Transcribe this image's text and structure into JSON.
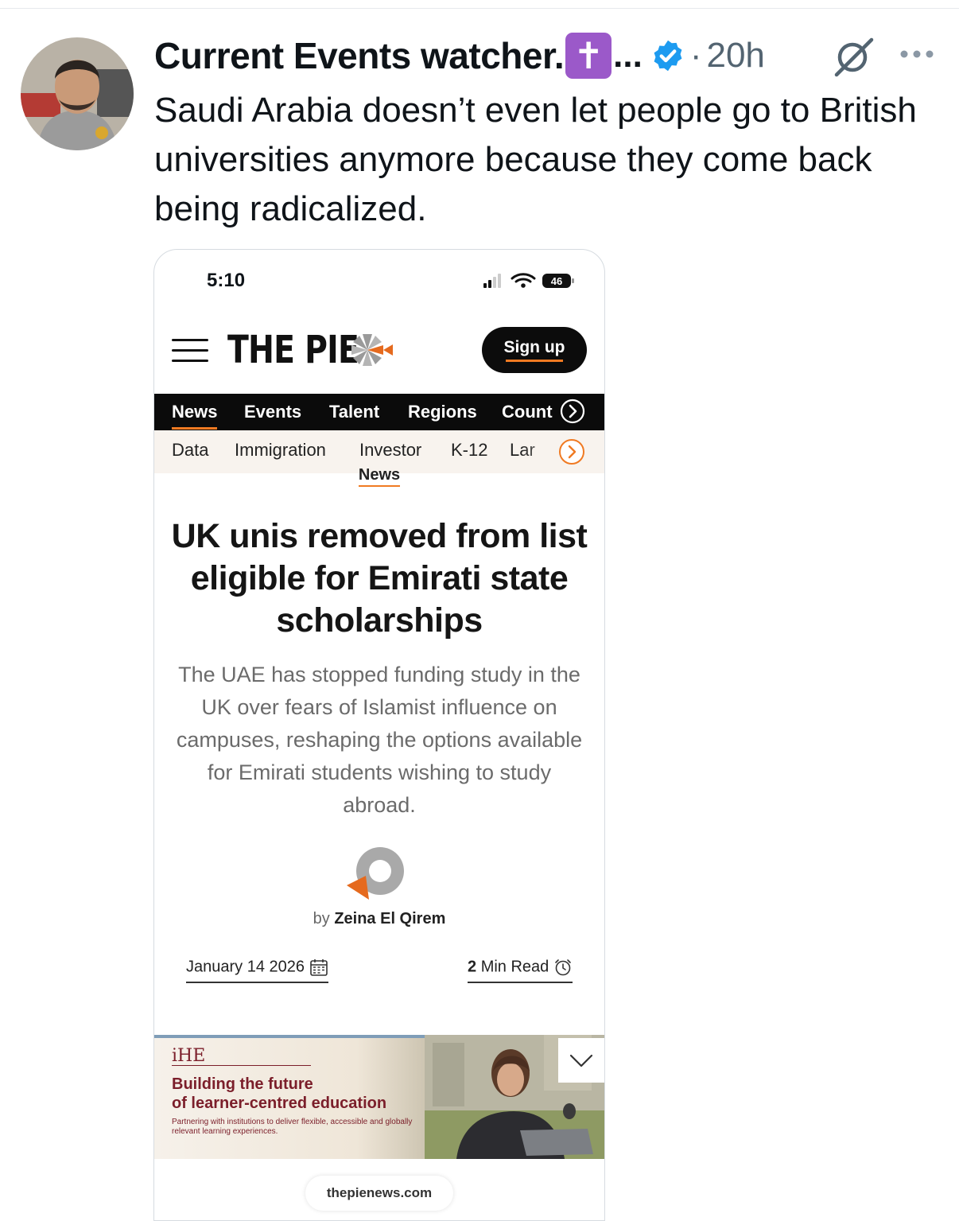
{
  "tweet": {
    "author_name": "Current Events watcher.",
    "author_emoji": "✝",
    "truncation": "...",
    "separator": "·",
    "time": "20h",
    "text": "Saudi Arabia doesn’t even let people go to British universities anymore because they come back being radicalized."
  },
  "screenshot": {
    "status_time": "5:10",
    "battery": "46",
    "site": {
      "logo": "THE PIE",
      "signup_label": "Sign up",
      "nav": [
        "News",
        "Events",
        "Talent",
        "Regions",
        "Count"
      ],
      "subnav": [
        "Data",
        "Immigration",
        "Investor",
        "K-12",
        "Lar"
      ],
      "category": "News"
    },
    "article": {
      "headline": "UK unis removed from list eligible for Emirati state scholarships",
      "standfirst": "The UAE has stopped funding study in the UK over fears of Islamist influence on campuses, reshaping the options available for Emirati students wishing to study abroad.",
      "by_prefix": "by",
      "author": "Zeina El Qirem",
      "date": "January 14 2026",
      "read_num": "2",
      "read_text": "Min Read"
    },
    "ad": {
      "brand": "iHE",
      "headline_1": "Building the future",
      "headline_2": "of learner-centred education",
      "body": "Partnering with institutions to deliver flexible, accessible and globally relevant learning experiences."
    },
    "url": "thepienews.com"
  },
  "colors": {
    "accent_orange": "#f07a22",
    "verified_blue": "#1d9bf0",
    "ad_maroon": "#7b1e2a"
  }
}
